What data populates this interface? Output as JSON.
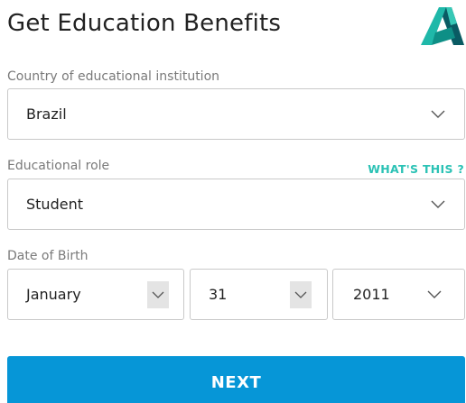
{
  "header": {
    "title": "Get Education Benefits",
    "logo_icon": "autodesk-logo-icon"
  },
  "form": {
    "country": {
      "label": "Country of educational institution",
      "value": "Brazil",
      "icon": "chevron-down-icon"
    },
    "role": {
      "label": "Educational role",
      "help_link": "WHAT'S THIS ?",
      "value": "Student",
      "icon": "chevron-down-icon"
    },
    "dob": {
      "label": "Date of Birth",
      "month": "January",
      "day": "31",
      "year": "2011"
    }
  },
  "actions": {
    "next_label": "NEXT"
  },
  "colors": {
    "accent": "#0696d7",
    "link": "#2bc2b5",
    "border": "#c9c9c9",
    "label": "#7a7a7a"
  }
}
